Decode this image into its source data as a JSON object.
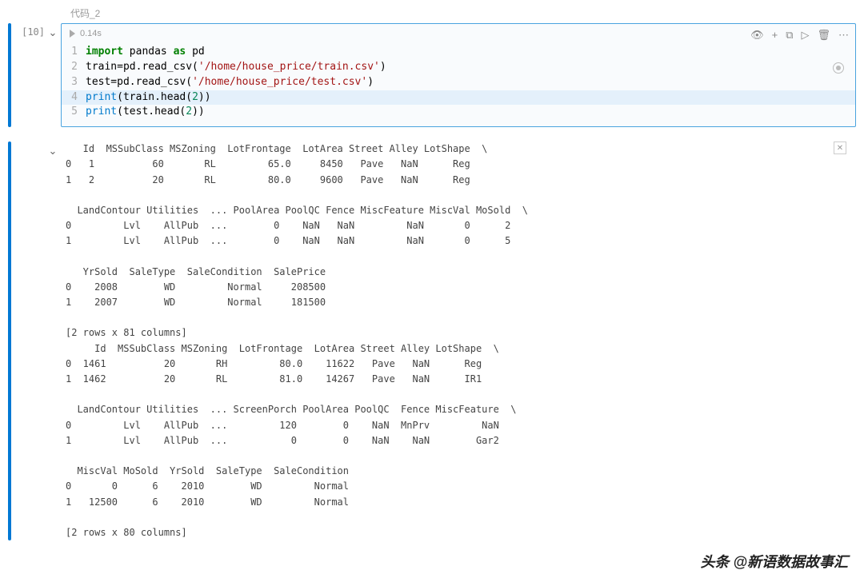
{
  "cell": {
    "title": "代码_2",
    "exec_count": "[10]",
    "run_time": "0.14s",
    "lines": [
      {
        "n": "1",
        "tokens": [
          [
            "kw",
            "import"
          ],
          [
            "nm",
            " pandas "
          ],
          [
            "kw",
            "as"
          ],
          [
            "nm",
            " pd"
          ]
        ]
      },
      {
        "n": "2",
        "tokens": [
          [
            "nm",
            "train=pd.read_csv("
          ],
          [
            "str",
            "'/home/house_price/train.csv'"
          ],
          [
            "nm",
            ")"
          ]
        ]
      },
      {
        "n": "3",
        "tokens": [
          [
            "nm",
            "test=pd.read_csv("
          ],
          [
            "str",
            "'/home/house_price/test.csv'"
          ],
          [
            "nm",
            ")"
          ]
        ]
      },
      {
        "n": "4",
        "hl": true,
        "tokens": [
          [
            "py-builtin",
            "print"
          ],
          [
            "nm",
            "(train.head("
          ],
          [
            "num",
            "2"
          ],
          [
            "nm",
            "))"
          ]
        ]
      },
      {
        "n": "5",
        "tokens": [
          [
            "py-builtin",
            "print"
          ],
          [
            "nm",
            "(test.head("
          ],
          [
            "num",
            "2"
          ],
          [
            "nm",
            "))"
          ]
        ]
      }
    ]
  },
  "toolbar": {
    "view": "👁",
    "add": "+",
    "split": "⧉",
    "run": "▷",
    "delete": "🗑",
    "more": "⋯"
  },
  "output": "   Id  MSSubClass MSZoning  LotFrontage  LotArea Street Alley LotShape  \\\n0   1          60       RL         65.0     8450   Pave   NaN      Reg   \n1   2          20       RL         80.0     9600   Pave   NaN      Reg   \n\n  LandContour Utilities  ... PoolArea PoolQC Fence MiscFeature MiscVal MoSold  \\\n0         Lvl    AllPub  ...        0    NaN   NaN         NaN       0      2   \n1         Lvl    AllPub  ...        0    NaN   NaN         NaN       0      5   \n\n   YrSold  SaleType  SaleCondition  SalePrice  \n0    2008        WD         Normal     208500  \n1    2007        WD         Normal     181500  \n\n[2 rows x 81 columns]\n     Id  MSSubClass MSZoning  LotFrontage  LotArea Street Alley LotShape  \\\n0  1461          20       RH         80.0    11622   Pave   NaN      Reg   \n1  1462          20       RL         81.0    14267   Pave   NaN      IR1   \n\n  LandContour Utilities  ... ScreenPorch PoolArea PoolQC  Fence MiscFeature  \\\n0         Lvl    AllPub  ...         120        0    NaN  MnPrv         NaN   \n1         Lvl    AllPub  ...           0        0    NaN    NaN        Gar2   \n\n  MiscVal MoSold  YrSold  SaleType  SaleCondition  \n0       0      6    2010        WD         Normal  \n1   12500      6    2010        WD         Normal  \n\n[2 rows x 80 columns]",
  "watermark": "头条 @新语数据故事汇"
}
